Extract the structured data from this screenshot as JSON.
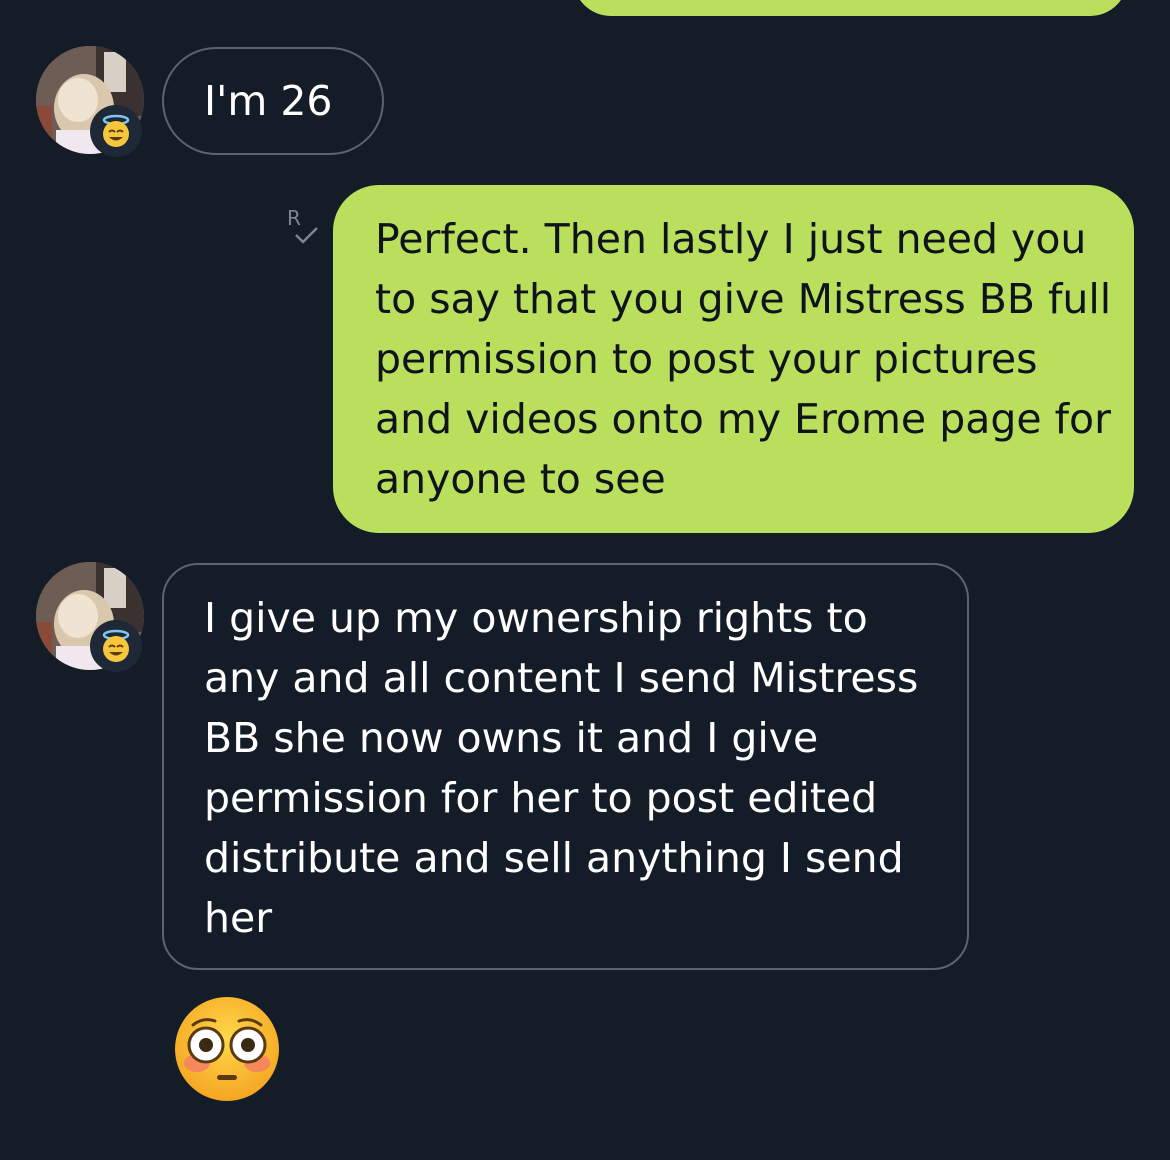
{
  "messages": [
    {
      "id": "m1",
      "direction": "outgoing",
      "text": ""
    },
    {
      "id": "m2",
      "direction": "incoming",
      "text": "I'm 26"
    },
    {
      "id": "m3",
      "direction": "outgoing",
      "text": "Perfect. Then lastly I just need you to say that you give Mistress BB full permission to post your pictures and videos onto my Erome page for anyone to see",
      "receipt_icon": "read-receipt-icon"
    },
    {
      "id": "m4",
      "direction": "incoming",
      "text": "I give up my ownership rights to any and all content I send Mistress BB she now owns it and I give permission for her to post edited distribute and sell anything I send her"
    },
    {
      "id": "m5",
      "direction": "incoming",
      "emoji": "flushed-face-emoji"
    }
  ],
  "contact": {
    "avatar_icon": "avatar-photo",
    "badge_icon": "smiling-face-with-halo-icon"
  },
  "colors": {
    "background": "#141c28",
    "outgoing_bubble": "#b9df5d",
    "incoming_border": "#5c636e",
    "incoming_text": "#ffffff",
    "outgoing_text": "#0f141c"
  }
}
